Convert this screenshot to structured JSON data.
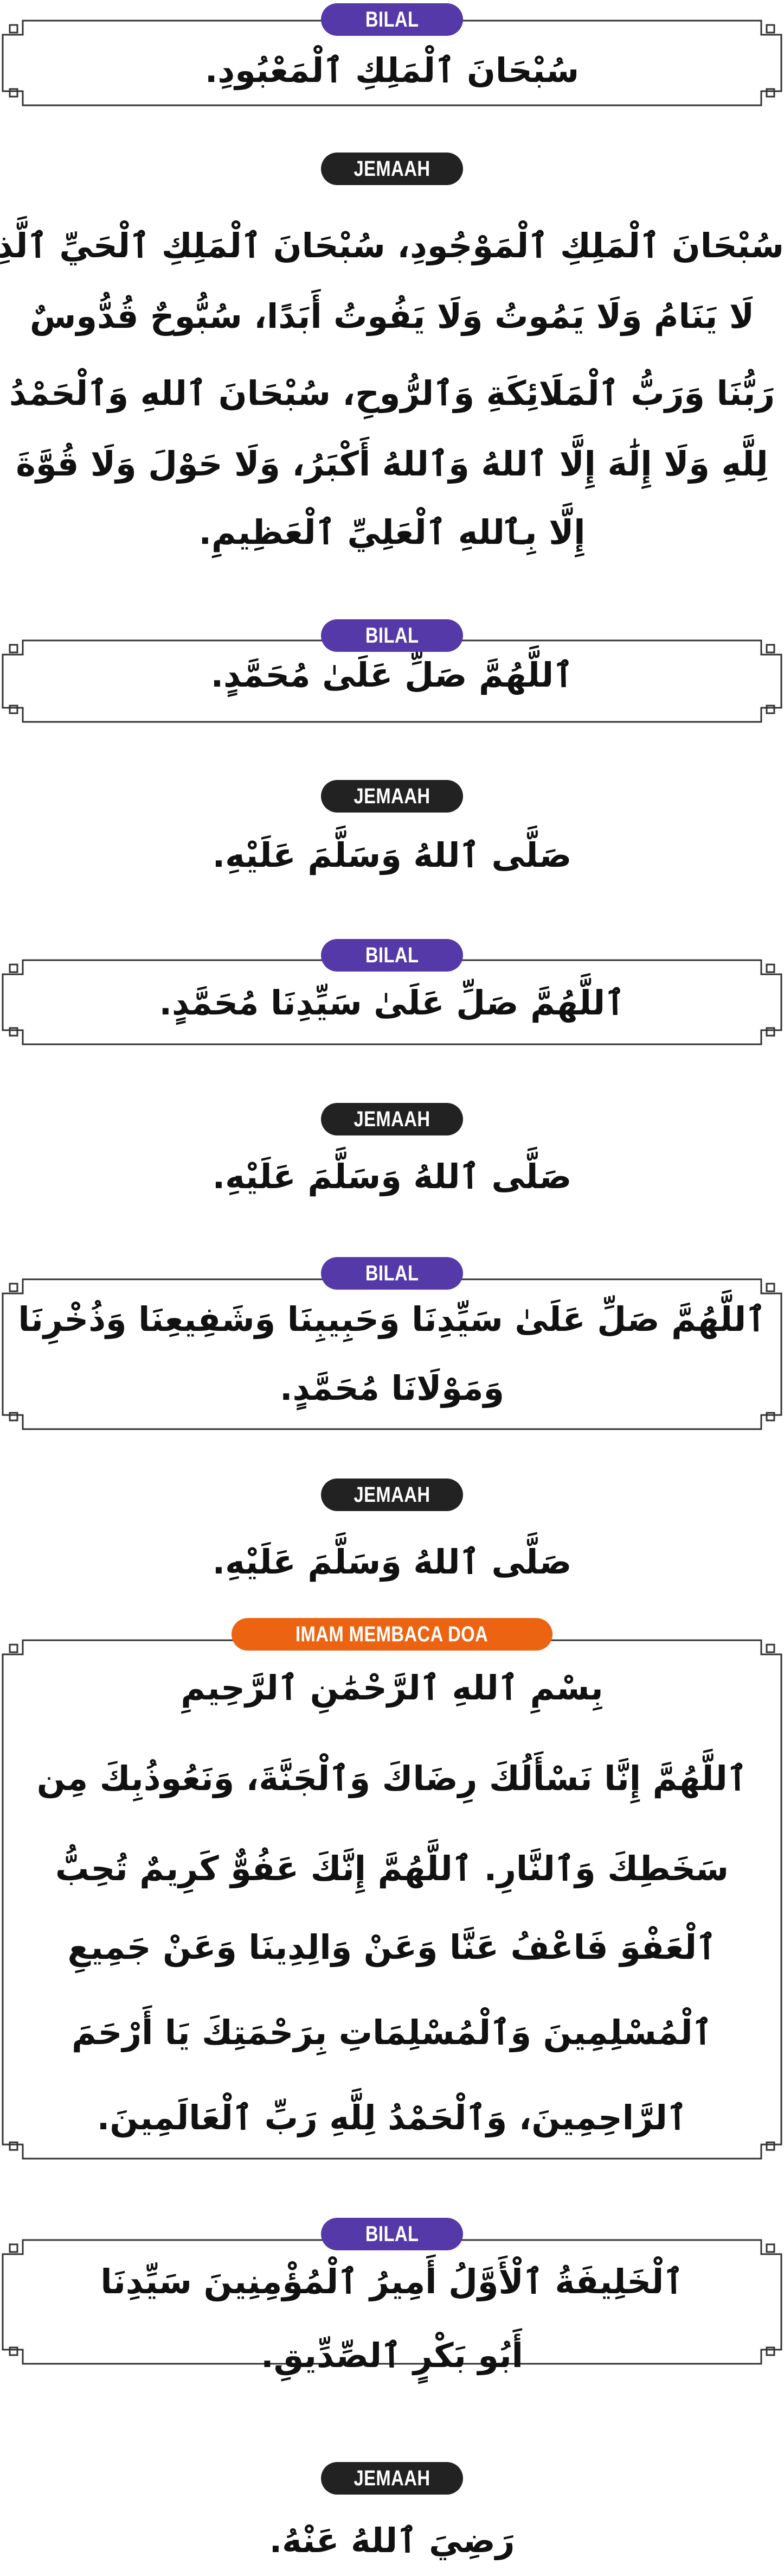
{
  "colors": {
    "bilal": "#5539a8",
    "jemaah": "#222222",
    "imam": "#ec6412",
    "frame": "#333333"
  },
  "sections": [
    {
      "speaker": "BILAL",
      "lines": [
        "سُبْحَانَ ٱلْمَلِكِ ٱلْمَعْبُودِ."
      ]
    },
    {
      "speaker": "JEMAAH",
      "lines": [
        "سُبْحَانَ ٱلْمَلِكِ ٱلْمَوْجُودِ، سُبْحَانَ ٱلْمَلِكِ ٱلْحَيِّ ٱلَّذِى",
        "لَا يَنَامُ وَلَا يَمُوتُ وَلَا يَفُوتُ أَبَدًا، سُبُّوحٌ قُدُّوسٌ",
        "رَبُّنَا وَرَبُّ ٱلْمَلَائِكَةِ وَٱلرُّوحِ، سُبْحَانَ ٱللهِ وَٱلْحَمْدُ",
        "لِلَّهِ وَلَا إِلَٰهَ إِلَّا ٱللهُ وَٱللهُ أَكْبَرُ، وَلَا حَوْلَ وَلَا قُوَّةَ",
        "إِلَّا بِٱللهِ ٱلْعَلِيِّ ٱلْعَظِيمِ."
      ]
    },
    {
      "speaker": "BILAL",
      "lines": [
        "ٱللَّهُمَّ صَلِّ عَلَىٰ مُحَمَّدٍ."
      ]
    },
    {
      "speaker": "JEMAAH",
      "lines": [
        "صَلَّى ٱللهُ وَسَلَّمَ عَلَيْهِ."
      ]
    },
    {
      "speaker": "BILAL",
      "lines": [
        "ٱللَّهُمَّ صَلِّ عَلَىٰ سَيِّدِنَا مُحَمَّدٍ."
      ]
    },
    {
      "speaker": "JEMAAH",
      "lines": [
        "صَلَّى ٱللهُ وَسَلَّمَ عَلَيْهِ."
      ]
    },
    {
      "speaker": "BILAL",
      "lines": [
        "ٱللَّهُمَّ صَلِّ عَلَىٰ سَيِّدِنَا وَحَبِيبِنَا وَشَفِيعِنَا وَذُخْرِنَا",
        "وَمَوْلَانَا مُحَمَّدٍ."
      ]
    },
    {
      "speaker": "JEMAAH",
      "lines": [
        "صَلَّى ٱللهُ وَسَلَّمَ عَلَيْهِ."
      ]
    },
    {
      "speaker": "IMAM MEMBACA DOA",
      "lines": [
        "بِسْمِ ٱللهِ ٱلرَّحْمَٰنِ ٱلرَّحِيمِ",
        "ٱللَّهُمَّ إِنَّا نَسْأَلُكَ رِضَاكَ وَٱلْجَنَّةَ، وَنَعُوذُبِكَ مِن",
        "سَخَطِكَ وَٱلنَّارِ. ٱللَّهُمَّ إِنَّكَ عَفُوٌّ كَرِيمٌ تُحِبُّ",
        "ٱلْعَفْوَ فَاعْفُ عَنَّا وَعَنْ وَالِدِينَا وَعَنْ جَمِيعِ",
        "ٱلْمُسْلِمِينَ وَٱلْمُسْلِمَاتِ بِرَحْمَتِكَ يَا أَرْحَمَ",
        "ٱلرَّاحِمِينَ، وَٱلْحَمْدُ لِلَّهِ رَبِّ ٱلْعَالَمِينَ."
      ]
    },
    {
      "speaker": "BILAL",
      "lines": [
        "ٱلْخَلِيفَةُ ٱلْأَوَّلُ أَمِيرُ ٱلْمُؤْمِنِينَ سَيِّدِنَا",
        "أَبُو بَكْرٍ ٱلصِّدِّيقِ."
      ]
    },
    {
      "speaker": "JEMAAH",
      "lines": [
        "رَضِيَ ٱللهُ عَنْهُ."
      ]
    }
  ]
}
